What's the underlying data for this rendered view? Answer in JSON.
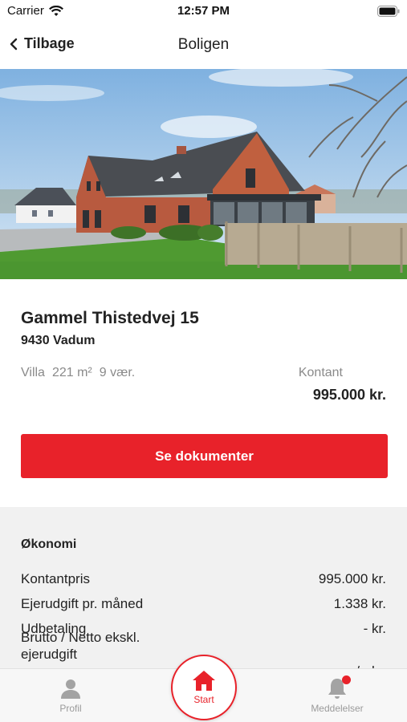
{
  "status": {
    "carrier": "Carrier",
    "time": "12:57 PM"
  },
  "nav": {
    "back_label": "Tilbage",
    "title": "Boligen"
  },
  "property": {
    "address": "Gammel Thistedvej 15",
    "postal": "9430 Vadum",
    "type": "Villa",
    "area": "221 m²",
    "rooms": "9 vær.",
    "price_label": "Kontant",
    "price": "995.000 kr."
  },
  "actions": {
    "documents_label": "Se dokumenter"
  },
  "economy": {
    "title": "Økonomi",
    "rows": [
      {
        "label": "Kontantpris",
        "value": "995.000 kr."
      },
      {
        "label": "Ejerudgift pr. måned",
        "value": "1.338 kr."
      },
      {
        "label": "Udbetaling",
        "value": "- kr."
      },
      {
        "label": "Brutto / Netto ekskl. ejerudgift",
        "value": "- / - kr."
      }
    ]
  },
  "tabs": {
    "profile": "Profil",
    "start": "Start",
    "messages": "Meddelelser"
  },
  "colors": {
    "accent": "#e8222a",
    "text": "#222222",
    "muted": "#8a8a8a",
    "panel": "#f1f1f1"
  },
  "icons": [
    "wifi-icon",
    "battery-icon",
    "chevron-left-icon",
    "person-icon",
    "home-icon",
    "bell-icon"
  ]
}
